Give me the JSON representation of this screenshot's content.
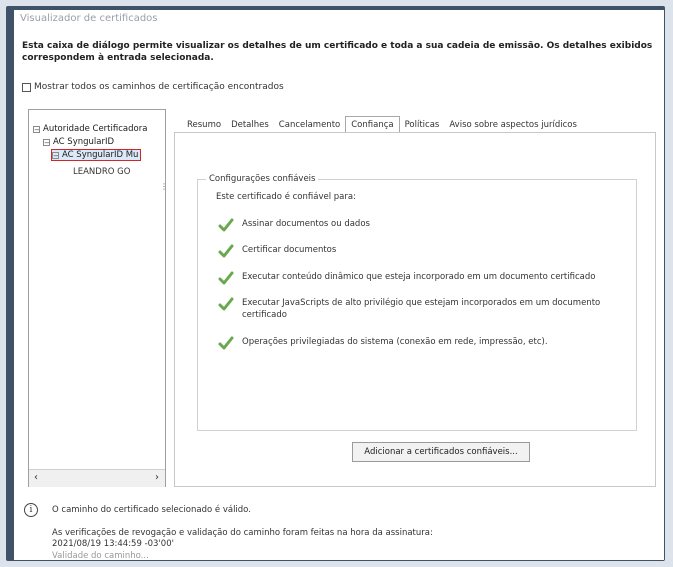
{
  "dialog": {
    "title": "Visualizador de certificados",
    "description": "Esta caixa de diálogo permite visualizar os detalhes de um certificado e toda a sua cadeia de emissão. Os detalhes exibidos correspondem à entrada selecionada.",
    "show_all_paths_label": "Mostrar todos os caminhos de certificação encontrados"
  },
  "tree": {
    "items": [
      {
        "label": "Autoridade Certificadora"
      },
      {
        "label": "AC SyngularID"
      },
      {
        "label": "AC SyngularID Mu"
      }
    ],
    "leaf": "LEANDRO GO"
  },
  "tabs": [
    {
      "label": "Resumo"
    },
    {
      "label": "Detalhes"
    },
    {
      "label": "Cancelamento"
    },
    {
      "label": "Confiança"
    },
    {
      "label": "Políticas"
    },
    {
      "label": "Aviso sobre aspectos jurídicos"
    }
  ],
  "trust": {
    "group_title": "Configurações confiáveis",
    "intro": "Este certificado é confiável para:",
    "items": [
      {
        "label": "Assinar documentos ou dados"
      },
      {
        "label": "Certificar documentos"
      },
      {
        "label": "Executar conteúdo dinâmico que esteja incorporado em um documento certificado"
      },
      {
        "label": "Executar JavaScripts de alto privilégio que estejam incorporados em um documento certificado"
      },
      {
        "label": "Operações privilegiadas do sistema (conexão em rede, impressão, etc)."
      }
    ],
    "add_button": "Adicionar a certificados confiáveis..."
  },
  "status": {
    "info_glyph": "i",
    "path_valid": "O caminho do certificado selecionado é válido.",
    "verification_text": "As verificações de revogação e validação do caminho foram feitas na hora da assinatura:",
    "verification_time": "2021/08/19 13:44:59 -03'00'",
    "cut_text": "Validade do caminho..."
  },
  "colors": {
    "window_frame": "#3f5268",
    "selection_border": "#d3242a",
    "check_green": "#6aa84f"
  }
}
